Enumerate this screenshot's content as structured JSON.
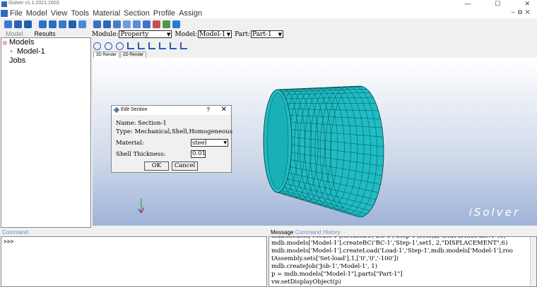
{
  "window": {
    "title": "iSolver v1.1.2021.1003",
    "controls": [
      "—",
      "☐",
      "✕"
    ]
  },
  "menu": {
    "items": [
      "File",
      "Model",
      "View",
      "Tools",
      "Material",
      "Section",
      "Profile",
      "Assign"
    ],
    "mdi_controls": "–⧉✕"
  },
  "toolbar": {
    "icons": [
      {
        "name": "new-file-icon",
        "color": "#3a78d8"
      },
      {
        "name": "open-folder-icon",
        "color": "#2a60b8"
      },
      {
        "name": "save-icon",
        "color": "#1f5fb0"
      },
      {
        "name": "sep",
        "color": ""
      },
      {
        "name": "create-part-icon",
        "color": "#2b72c8"
      },
      {
        "name": "extrude-icon",
        "color": "#2b6cc0"
      },
      {
        "name": "revolve-icon",
        "color": "#357ad0"
      },
      {
        "name": "sweep-icon",
        "color": "#2260b0"
      },
      {
        "name": "shell-icon",
        "color": "#4a88d8"
      },
      {
        "name": "sep",
        "color": ""
      },
      {
        "name": "mesh-icon",
        "color": "#3c6fc0"
      },
      {
        "name": "grid-icon",
        "color": "#2f66b8"
      },
      {
        "name": "material-icon",
        "color": "#4a7cc4"
      },
      {
        "name": "sphere-icon",
        "color": "#6aa0e0"
      },
      {
        "name": "section-icon",
        "color": "#5a8ed8"
      },
      {
        "name": "boundary-icon",
        "color": "#3b74c8"
      },
      {
        "name": "load-icon",
        "color": "#c85050"
      },
      {
        "name": "cloud-icon",
        "color": "#4a9a4a"
      },
      {
        "name": "info-icon",
        "color": "#2a78d8"
      }
    ]
  },
  "left_panel": {
    "tabs": [
      "Model",
      "Results"
    ],
    "tree": {
      "models_label": "Models",
      "model_1": "Model-1",
      "jobs_label": "Jobs"
    }
  },
  "module_bar": {
    "module_label": "Module:",
    "module_value": "Property",
    "model_label": "Model:",
    "model_value": "Model-1",
    "part_label": "Part:",
    "part_value": "Part-1"
  },
  "view_toolbar": {
    "icons": [
      "pan-icon",
      "rotate-icon",
      "fit-view-icon",
      "view-front-icon",
      "view-back-icon",
      "view-top-icon",
      "view-bottom-icon",
      "view-left-icon",
      "view-right-icon"
    ]
  },
  "render_tabs": [
    "3D Render",
    "2D Render"
  ],
  "viewport": {
    "watermark": "iSolver",
    "mesh_color": "#1fbcc4"
  },
  "dialog": {
    "title": "Edit Section",
    "help": "?",
    "close": "✕",
    "name_line": "Name: Section-1",
    "type_line": "Type: Mechanical,Shell,Homogeneous",
    "material_label": "Material:",
    "material_value": "steel",
    "thickness_label": "Shell Thickness:",
    "thickness_value": "0.01",
    "ok_label": "OK",
    "cancel_label": "Cancel"
  },
  "command": {
    "header": "Command",
    "prompt": ">>>"
  },
  "message": {
    "tabs": [
      "Message",
      "Command History"
    ],
    "lines": [
      "mdb.models['Model-1'].createBC('BC-1','Step-1',set1, 2,\"DISPLACEMENT\",6)",
      "mdb.models['Model-1'].createLoad('Load-1','Step-1',mdb.models['Model-1'].roo",
      "tAssembly.sets['Set-load'],1,['0','0','-100'])",
      "mdb.createJob('Job-1','Model-1', 1)",
      "p = mdb.models[\"Model-1\"].parts[\"Part-1\"]",
      "vw.setDisplayObject(p)"
    ]
  }
}
